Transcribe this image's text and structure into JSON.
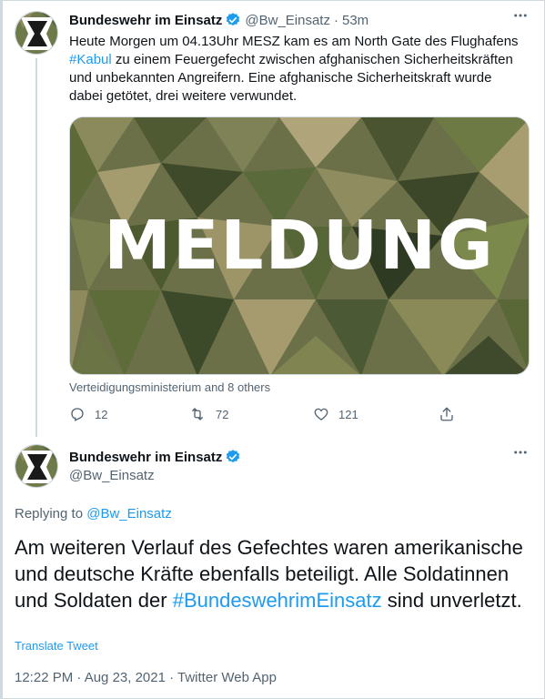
{
  "tweet1": {
    "name": "Bundeswehr im Einsatz",
    "handle": "@Bw_Einsatz",
    "separator": "·",
    "time": "53m",
    "text_part1": "Heute Morgen um 04.13Uhr MESZ kam es am North Gate des Flughafens ",
    "hashtag": "#Kabul",
    "text_part2": " zu einem Feuergefecht zwischen afghanischen Sicherheitskräften und unbekannten Angreifern. Eine afghanische Sicherheitskraft wurde dabei getötet, drei weitere verwundet.",
    "image_text": "MELDUNG",
    "tagged": "Verteidigungsministerium and 8 others",
    "replies": "12",
    "retweets": "72",
    "likes": "121"
  },
  "tweet2": {
    "name": "Bundeswehr im Einsatz",
    "handle": "@Bw_Einsatz",
    "replying_prefix": "Replying to ",
    "replying_handle": "@Bw_Einsatz",
    "text_part1": "Am weiteren Verlauf des Gefechtes waren amerikanische und deutsche Kräfte ebenfalls beteiligt. Alle Soldatinnen und Soldaten der ",
    "hashtag": "#BundeswehrimEinsatz",
    "text_part2": " sind unverletzt.",
    "translate": "Translate Tweet",
    "meta": "12:22 PM · Aug 23, 2021 · Twitter Web App"
  },
  "icons": {
    "verified": "verified-badge-icon",
    "more": "more-dots-icon",
    "reply": "reply-icon",
    "retweet": "retweet-icon",
    "like": "heart-icon",
    "share": "share-icon",
    "avatar": "iron-cross-icon"
  },
  "colors": {
    "accent": "#1d9bf0",
    "secondary_text": "#536471",
    "primary_text": "#0f1419"
  }
}
